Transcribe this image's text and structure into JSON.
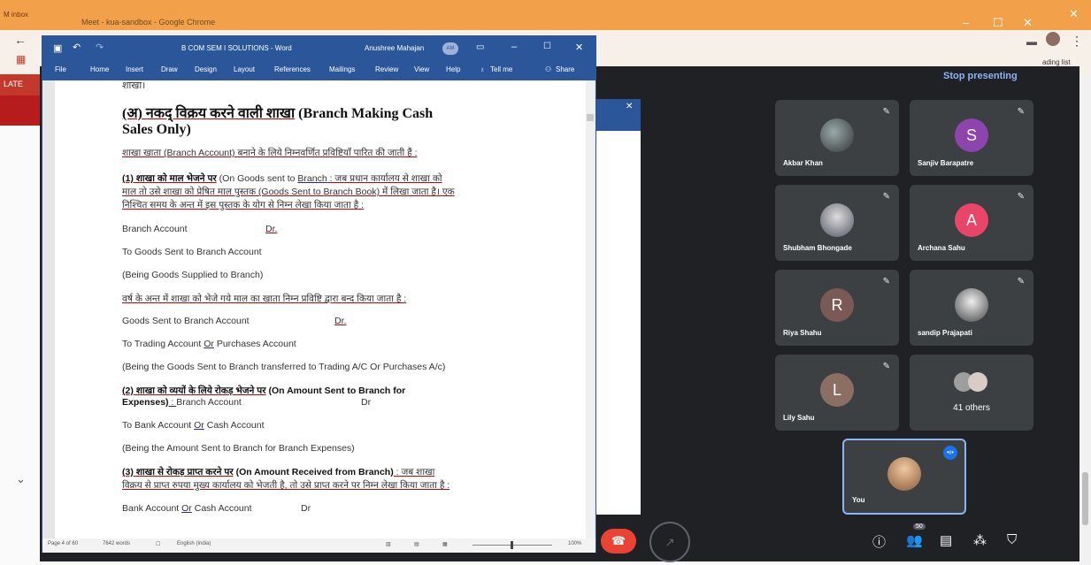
{
  "chrome": {
    "tab_gmail": "M inbox",
    "title": "Meet - kua-sandbox - Google Chrome",
    "reading_list": "ading list",
    "menu_icon": "more-vert-icon"
  },
  "meet": {
    "late_label": "LATE",
    "stop_presenting": "Stop presenting",
    "participants": [
      {
        "name": "Akbar Khan",
        "initial": "",
        "color": "",
        "muted": true
      },
      {
        "name": "Sanjiv Barapatre",
        "initial": "S",
        "color": "#8e44ad",
        "muted": true
      },
      {
        "name": "Shubham Bhongade",
        "initial": "",
        "color": "",
        "muted": true
      },
      {
        "name": "Archana Sahu",
        "initial": "A",
        "color": "#e84569",
        "muted": true
      },
      {
        "name": "Riya Shahu",
        "initial": "R",
        "color": "#7b5a55",
        "muted": true
      },
      {
        "name": "sandip Prajapati",
        "initial": "",
        "color": "",
        "muted": true
      },
      {
        "name": "Lily Sahu",
        "initial": "L",
        "color": "#8d6e63",
        "muted": true
      }
    ],
    "others_label": "41 others",
    "you_label": "You",
    "people_badge": "50"
  },
  "word": {
    "title": "B COM SEM I SOLUTIONS - Word",
    "user": "Anushree Mahajan",
    "user_initials": "AM",
    "ribbon_tabs": [
      "File",
      "Home",
      "Insert",
      "Draw",
      "Design",
      "Layout",
      "References",
      "Mailings",
      "Review",
      "View",
      "Help",
      "Tell me",
      "Share"
    ],
    "status": {
      "page": "Page 4 of 60",
      "words": "7642 words",
      "lang": "English (India)",
      "zoom": "100%"
    },
    "doc": {
      "top_word": "शाखा।",
      "heading_hi": "(अ) नकद् विक्रय करने वाली शाखा",
      "heading_en": "(Branch Making Cash",
      "heading_en2": "Sales Only)",
      "intro": "शाखा खाता (Branch Account) बनाने के लिये निम्नवर्णित प्रविष्टियाँ पारित की जाती हैं :",
      "p1_hi": "(1) शाखा को माल भेजने पर",
      "p1_a": " (On Goods sent to ",
      "p1_branch": "Branch",
      "p1_b": " : जब प्रधान कार्यालय से शाखा को",
      "p1_line2": "माल तो उसे शाखा को प्रेषित माल पुस्तक (Goods Sent to Branch Book) में लिखा जाता है। एक",
      "p1_line3": "निश्चित समय के अन्त में इस पुस्तक के योग से निम्न लेखा किया जाता है :",
      "e1_a": "Branch Account",
      "e1_dr": "Dr.",
      "e1_b": "To Goods Sent to Branch Account",
      "e1_c": "(Being Goods Supplied to Branch)",
      "p_year": "वर्ष के अन्त में शाखा को भेजे गये माल का खाता निम्न प्रविष्टि द्वारा बन्द किया जाता है :",
      "e2_a": "Goods Sent to Branch Account",
      "e2_dr": "Dr.",
      "e2_b": "To Trading Account ",
      "e2_or": "Or",
      "e2_b2": " Purchases Account",
      "e2_c": "(Being the Goods Sent to Branch transferred to Trading A/C Or Purchases A/c)",
      "p2_hi": "(2) शाखा को व्ययों के लिये रोकड़ भेजने पर",
      "p2_en": " (On Amount Sent to Branch for",
      "p2_line2a": "Expenses)",
      "p2_line2b": " : ",
      "p2_line2c": "Branch Account",
      "p2_dr": "Dr",
      "e3_a": "To Bank Account ",
      "e3_or": "Or",
      "e3_a2": " Cash Account",
      "e3_b": "(Being the Amount Sent to Branch for Branch Expenses)",
      "p3_hi": "(3) शाखा से रोकड़ प्राप्त करने पर",
      "p3_en": " (On Amount Received from Branch)",
      "p3_b": " : जब शाखा",
      "p3_line2": "विक्रय से प्राप्त रुपया मुख्य कार्यालय को भेजती है, तो उसे प्राप्त करने पर निम्न लेखा किया जाता है :",
      "e4_a": "Bank Account ",
      "e4_or": "Or",
      "e4_a2": " Cash Account",
      "e4_dr": "Dr"
    }
  }
}
